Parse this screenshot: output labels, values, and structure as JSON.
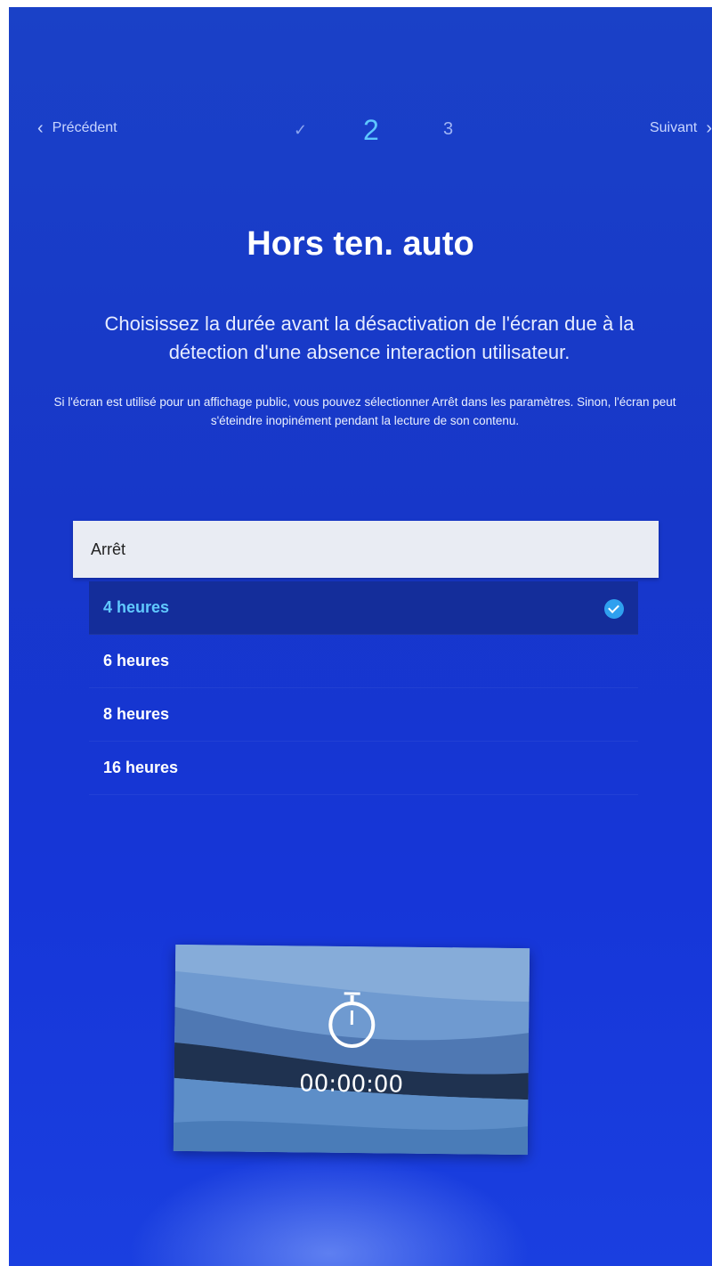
{
  "nav": {
    "prev_label": "Précédent",
    "next_label": "Suivant",
    "steps": {
      "done_mark": "✓",
      "current": "2",
      "next": "3"
    }
  },
  "title": "Hors ten. auto",
  "subtitle": "Choisissez la durée avant la désactivation de l'écran due à la détection d'une absence interaction utilisateur.",
  "note": "Si l'écran est utilisé pour un affichage public, vous pouvez sélectionner Arrêt dans les paramètres. Sinon, l'écran peut s'éteindre inopinément pendant la lecture de son contenu.",
  "options": [
    {
      "label": "Arrêt",
      "focused": true
    },
    {
      "label": "4 heures",
      "selected": true
    },
    {
      "label": "6 heures"
    },
    {
      "label": "8 heures"
    },
    {
      "label": "16 heures"
    }
  ],
  "preview": {
    "icon": "stopwatch-icon",
    "timer": "00:00:00"
  },
  "colors": {
    "background": "#1737c9",
    "accent": "#5ec7ff",
    "selected_row": "#142d9a",
    "focused_row": "#e9ecf3"
  }
}
